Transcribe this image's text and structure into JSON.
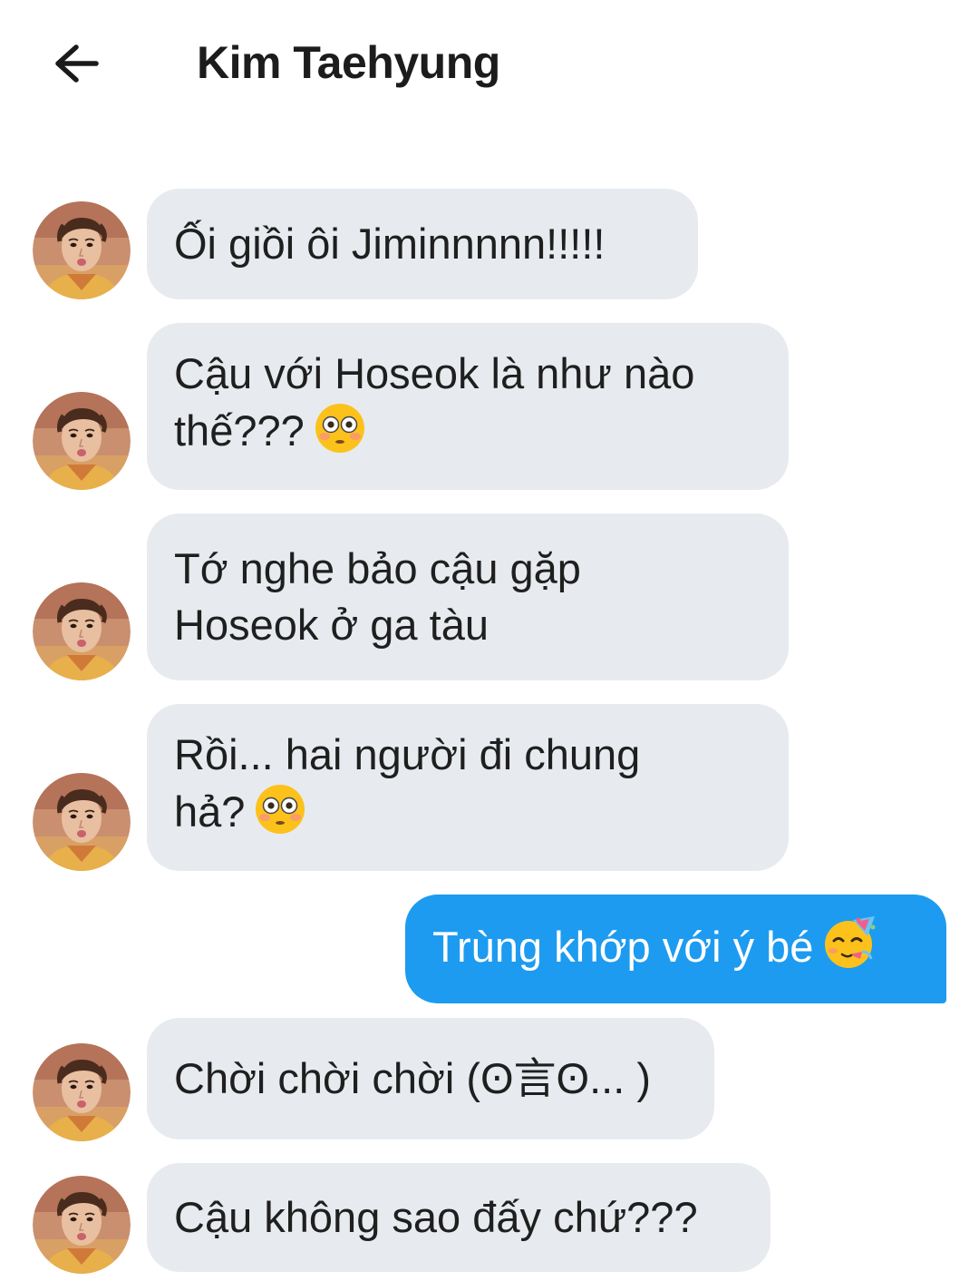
{
  "header": {
    "back_icon": "arrow-left-icon",
    "title": "Kim Taehyung"
  },
  "colors": {
    "incoming_bubble": "#e7ebef",
    "outgoing_bubble": "#1d9bf0",
    "text": "#1f1f1f"
  },
  "messages": [
    {
      "direction": "incoming",
      "text": "Ối giồi ôi Jiminnnnn!!!!!",
      "emoji": null
    },
    {
      "direction": "incoming",
      "text": "Cậu với Hoseok là như nào\nthế???",
      "emoji": "flushed-face-emoji"
    },
    {
      "direction": "incoming",
      "text": "Tớ nghe bảo cậu gặp\nHoseok ở ga tàu",
      "emoji": null
    },
    {
      "direction": "incoming",
      "text": "Rồi... hai người đi chung\nhả?",
      "emoji": "flushed-face-emoji"
    },
    {
      "direction": "outgoing",
      "text": "Trùng khớp với ý bé",
      "emoji": "partying-face-emoji"
    },
    {
      "direction": "incoming",
      "text": "Chời chời chời (ʘ言ʘ... )",
      "emoji": null
    },
    {
      "direction": "incoming",
      "text": "Cậu không sao đấy chứ???",
      "emoji": null
    }
  ]
}
